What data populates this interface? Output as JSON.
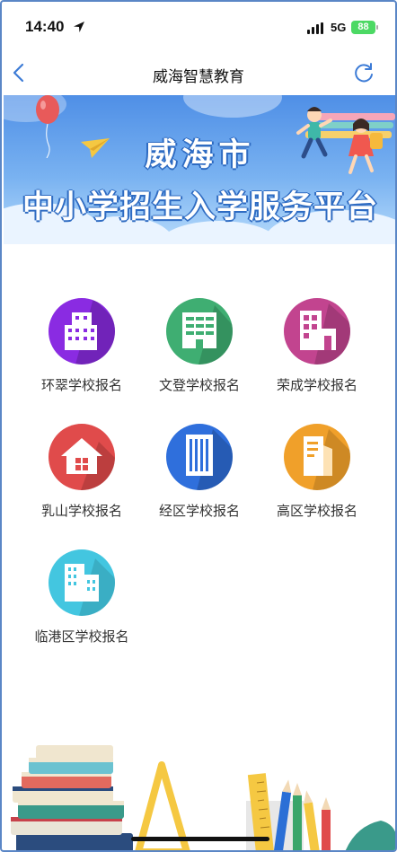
{
  "status_bar": {
    "time": "14:40",
    "network": "5G",
    "battery": "88"
  },
  "nav": {
    "title": "威海智慧教育",
    "back_icon": "chevron-left-icon",
    "refresh_icon": "refresh-icon"
  },
  "banner": {
    "title": "威海市",
    "subtitle": "中小学招生入学服务平台"
  },
  "tiles": [
    {
      "label": "环翠学校报名",
      "icon": "building-icon",
      "color": "#8a2be2"
    },
    {
      "label": "文登学校报名",
      "icon": "office-building-icon",
      "color": "#3fae72"
    },
    {
      "label": "荣成学校报名",
      "icon": "storefront-building-icon",
      "color": "#c2448f"
    },
    {
      "label": "乳山学校报名",
      "icon": "house-icon",
      "color": "#e04b4b"
    },
    {
      "label": "经区学校报名",
      "icon": "tower-building-icon",
      "color": "#2f6fdc"
    },
    {
      "label": "高区学校报名",
      "icon": "document-building-icon",
      "color": "#f0a02a"
    },
    {
      "label": "临港区学校报名",
      "icon": "apartment-building-icon",
      "color": "#43c6e0"
    }
  ]
}
